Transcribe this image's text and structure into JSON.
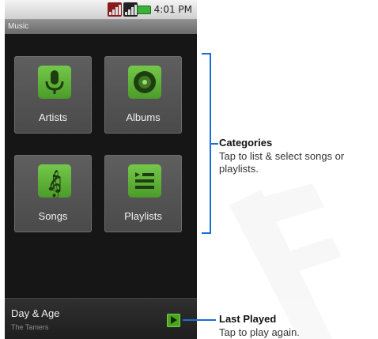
{
  "status_bar": {
    "time": "4:01 PM",
    "icons": [
      "signal-icon",
      "signal-icon",
      "battery-icon"
    ]
  },
  "app": {
    "title": "Music"
  },
  "categories": [
    {
      "label": "Artists",
      "icon": "microphone-icon"
    },
    {
      "label": "Albums",
      "icon": "disc-icon"
    },
    {
      "label": "Songs",
      "icon": "treble-clef-icon"
    },
    {
      "label": "Playlists",
      "icon": "list-icon"
    }
  ],
  "last_played": {
    "title": "Day & Age",
    "artist": "The Tamers",
    "icon": "play-icon"
  },
  "callouts": {
    "categories": {
      "title": "Categories",
      "body": "Tap to list & select songs or playlists."
    },
    "last_played": {
      "title": "Last Played",
      "body": "Tap to play again."
    }
  },
  "colors": {
    "accent_blue": "#1b6fd6",
    "icon_green": "#5fb53a",
    "screen_bg": "#161616"
  }
}
